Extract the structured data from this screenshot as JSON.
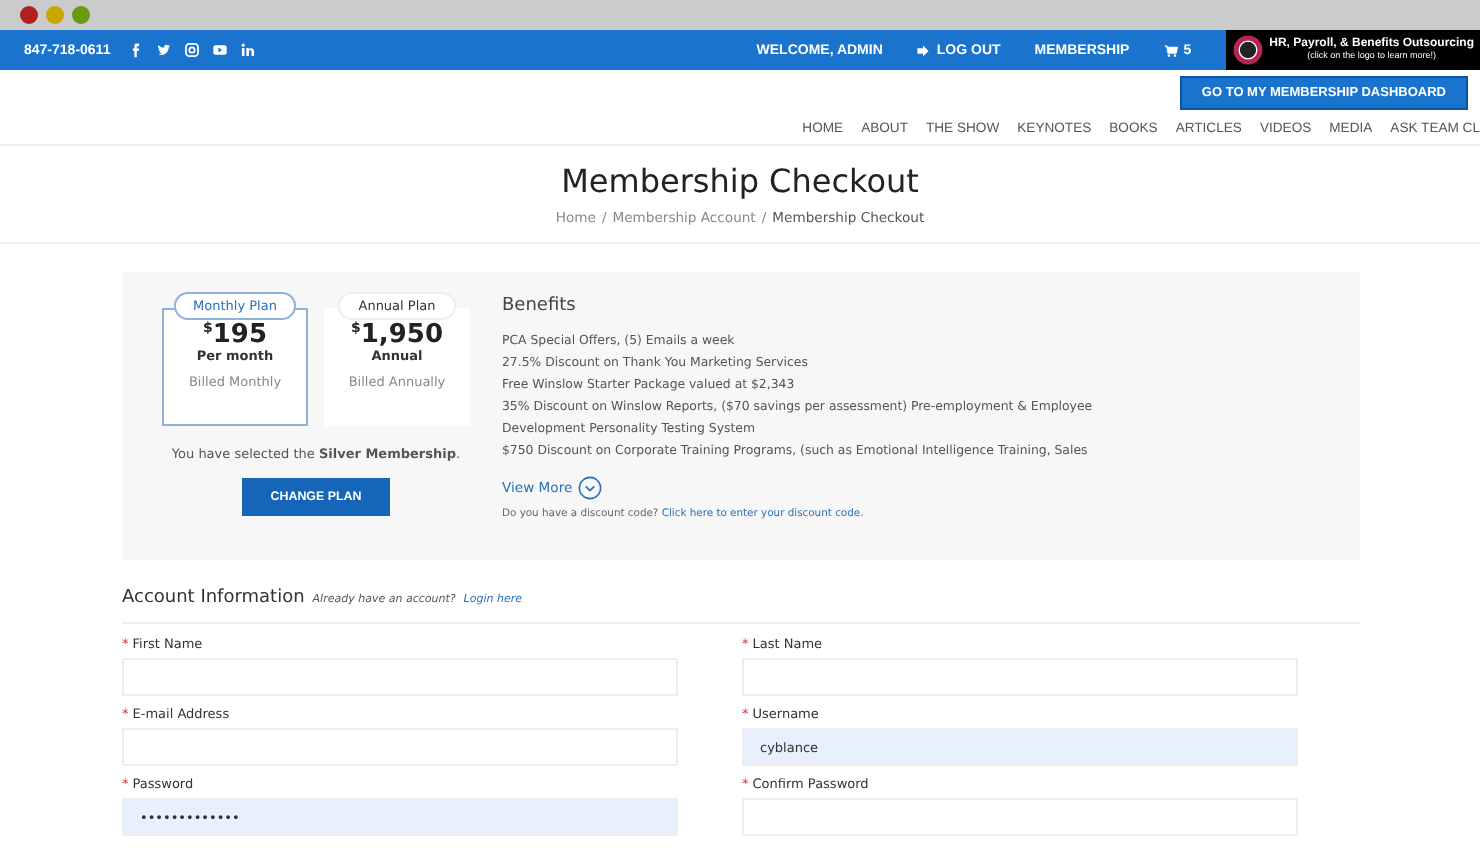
{
  "topbar": {
    "phone": "847-718-0611",
    "welcome": "WELCOME, ADMIN",
    "logout": "LOG OUT",
    "membership": "MEMBERSHIP",
    "cart_count": "5",
    "ad_title": "HR, Payroll, & Benefits Outsourcing",
    "ad_subtitle": "(click on the logo to learn more!)"
  },
  "dashboard_button": "GO TO MY MEMBERSHIP DASHBOARD",
  "nav": [
    "HOME",
    "ABOUT",
    "THE SHOW",
    "KEYNOTES",
    "BOOKS",
    "ARTICLES",
    "VIDEOS",
    "MEDIA",
    "ASK TEAM CL"
  ],
  "page_title": "Membership Checkout",
  "breadcrumb": {
    "separator": "/",
    "items": [
      "Home",
      "Membership Account",
      "Membership Checkout"
    ]
  },
  "plans": [
    {
      "label": "Monthly Plan",
      "currency": "$",
      "amount": "195",
      "period": "Per month",
      "billing": "Billed Monthly",
      "selected": true
    },
    {
      "label": "Annual Plan",
      "currency": "$",
      "amount": "1,950",
      "period": "Annual",
      "billing": "Billed Annually",
      "selected": false
    }
  ],
  "selected_note": "You have selected the **Silver Membership**.",
  "change_plan": "CHANGE PLAN",
  "benefits": {
    "title": "Benefits",
    "items": [
      "PCA Special Offers, (5) Emails a week",
      "27.5% Discount on Thank You Marketing Services",
      "Free Winslow Starter Package valued at $2,343",
      "35% Discount on Winslow Reports, ($70 savings per assessment) Pre-employment & Employee",
      "Development Personality Testing System",
      "$750 Discount on Corporate Training Programs, (such as Emotional Intelligence Training, Sales"
    ],
    "view_more": "View More",
    "discount_prompt": "Do you have a discount code?",
    "discount_link": "Click here to enter your discount code."
  },
  "account": {
    "title": "Account Information",
    "login_prompt": "Already have an account?",
    "login_link": "Login here",
    "fields": [
      {
        "label": "First Name",
        "mark": "*",
        "highlighted": false
      },
      {
        "label": "Last Name",
        "mark": "*",
        "highlighted": false
      },
      {
        "label": "E-mail Address",
        "mark": "*",
        "highlighted": false
      },
      {
        "label": "Username",
        "mark": "*",
        "value": "cyblance",
        "highlighted": true
      },
      {
        "label": "Password",
        "mark": "*",
        "value": "•••••••••••••",
        "highlighted": true
      },
      {
        "label": "Confirm Password",
        "mark": "*",
        "highlighted": false
      }
    ]
  }
}
